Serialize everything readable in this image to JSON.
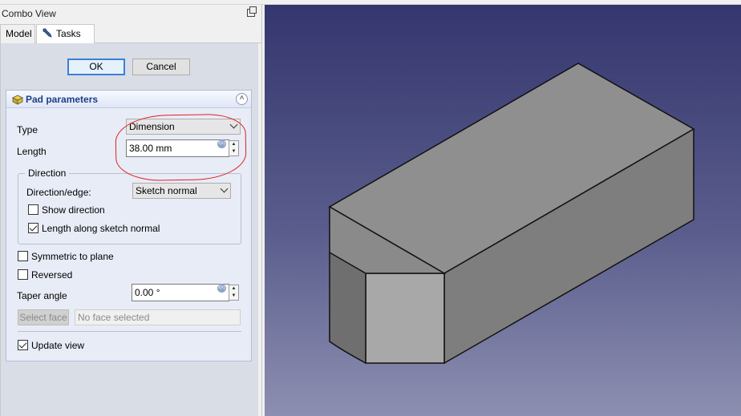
{
  "panel": {
    "title": "Combo View",
    "tabs": [
      "Model",
      "Tasks"
    ]
  },
  "dialog": {
    "ok_label": "OK",
    "cancel_label": "Cancel"
  },
  "pad_parameters": {
    "title": "Pad parameters",
    "type_label": "Type",
    "type_value": "Dimension",
    "length_label": "Length",
    "length_value": "38.00 mm",
    "direction": {
      "group_title": "Direction",
      "edge_label": "Direction/edge:",
      "edge_value": "Sketch normal",
      "show_direction_label": "Show direction",
      "show_direction_checked": false,
      "along_normal_label": "Length along sketch normal",
      "along_normal_checked": true
    },
    "symmetric_label": "Symmetric to plane",
    "symmetric_checked": false,
    "reversed_label": "Reversed",
    "reversed_checked": false,
    "taper_label": "Taper angle",
    "taper_value": "0.00 °",
    "select_face_label": "Select face",
    "no_face_text": "No face selected",
    "update_view_label": "Update view",
    "update_view_checked": true
  },
  "icons": {
    "float": "float-window-icon",
    "tasks": "wrench-icon",
    "pad": "pad-icon",
    "collapse": "collapse-up-icon",
    "expression": "fx-icon"
  },
  "colors": {
    "annotation_circle": "#e02020",
    "view_background_top": "#34366e",
    "view_background_bottom": "#8d8fb1",
    "solid_face_top": "#8f8f8f",
    "solid_face_side": "#7e7e7e",
    "solid_face_front": "#a8a8a8"
  }
}
